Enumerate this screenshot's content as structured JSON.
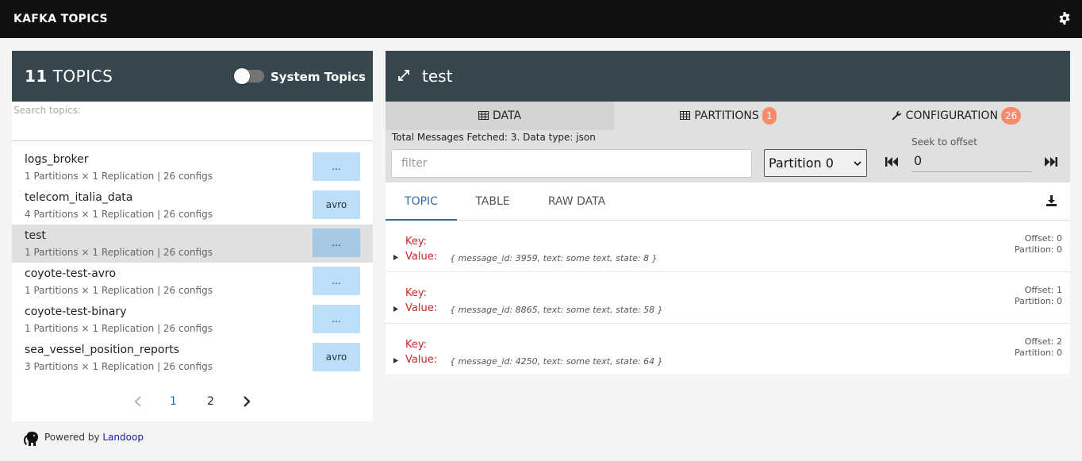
{
  "header": {
    "title": "KAFKA TOPICS",
    "settings_icon": "gear-icon"
  },
  "topics_panel": {
    "count": "11",
    "count_suffix": "TOPICS",
    "system_topics_label": "System Topics",
    "system_topics_enabled": false,
    "search_placeholder": "Search topics:",
    "items": [
      {
        "name": "logs_broker",
        "meta": "1 Partitions × 1 Replication | 26 configs",
        "type": "..."
      },
      {
        "name": "telecom_italia_data",
        "meta": "4 Partitions × 1 Replication | 26 configs",
        "type": "avro"
      },
      {
        "name": "test",
        "meta": "1 Partitions × 1 Replication | 26 configs",
        "type": "..."
      },
      {
        "name": "coyote-test-avro",
        "meta": "1 Partitions × 1 Replication | 26 configs",
        "type": "..."
      },
      {
        "name": "coyote-test-binary",
        "meta": "1 Partitions × 1 Replication | 26 configs",
        "type": "..."
      },
      {
        "name": "sea_vessel_position_reports",
        "meta": "3 Partitions × 1 Replication | 26 configs",
        "type": "avro"
      }
    ],
    "pagination": {
      "pages": [
        "1",
        "2"
      ],
      "current": "1"
    }
  },
  "footer": {
    "powered_by": "Powered by",
    "brand": "Landoop"
  },
  "detail": {
    "topic_name": "test",
    "tabs": [
      {
        "label": "DATA",
        "badge": ""
      },
      {
        "label": "PARTITIONS",
        "badge": "1"
      },
      {
        "label": "CONFIGURATION",
        "badge": "26"
      }
    ],
    "fetched_text": "Total Messages Fetched: 3. Data type: json",
    "filter_placeholder": "filter",
    "partition_selected": "Partition 0",
    "seek_label": "Seek to offset",
    "seek_value": "0",
    "subtabs": [
      "TOPIC",
      "TABLE",
      "RAW DATA"
    ],
    "messages": [
      {
        "key_label": "Key:",
        "value_label": "Value:",
        "value": "{ message_id: 3959, text: some text, state: 8 }",
        "offset": "Offset: 0",
        "partition": "Partition: 0"
      },
      {
        "key_label": "Key:",
        "value_label": "Value:",
        "value": "{ message_id: 8865, text: some text, state: 58 }",
        "offset": "Offset: 1",
        "partition": "Partition: 0"
      },
      {
        "key_label": "Key:",
        "value_label": "Value:",
        "value": "{ message_id: 4250, text: some text, state: 64 }",
        "offset": "Offset: 2",
        "partition": "Partition: 0"
      }
    ]
  }
}
